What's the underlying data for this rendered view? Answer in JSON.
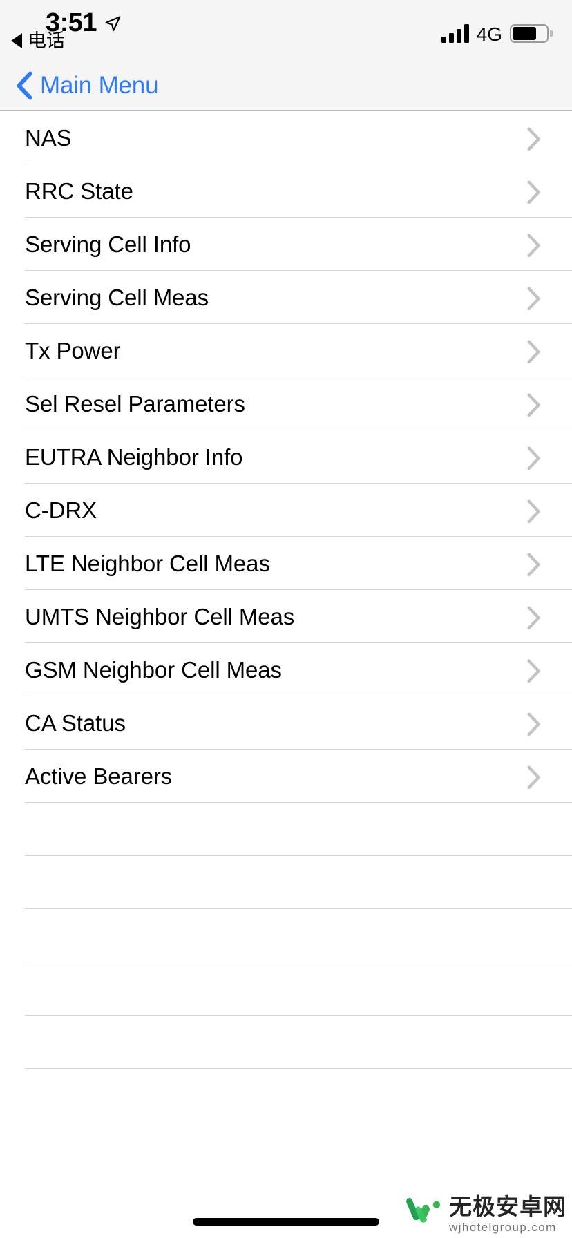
{
  "status_bar": {
    "time": "3:51",
    "location_icon": "location-arrow-icon",
    "return_indicator": {
      "icon": "back-triangle-icon",
      "label": "电话"
    },
    "signal_icon": "cellular-signal-bars-icon",
    "signal_bars": 4,
    "network_type": "4G",
    "battery_icon": "battery-icon"
  },
  "nav_bar": {
    "back_icon": "chevron-left-icon",
    "back_label": "Main Menu"
  },
  "list": {
    "disclosure_icon": "chevron-right-icon",
    "items": [
      {
        "label": "NAS"
      },
      {
        "label": "RRC State"
      },
      {
        "label": "Serving Cell Info"
      },
      {
        "label": "Serving Cell Meas"
      },
      {
        "label": "Tx Power"
      },
      {
        "label": "Sel Resel Parameters"
      },
      {
        "label": "EUTRA Neighbor Info"
      },
      {
        "label": "C-DRX"
      },
      {
        "label": "LTE Neighbor Cell Meas"
      },
      {
        "label": "UMTS Neighbor Cell Meas"
      },
      {
        "label": "GSM Neighbor Cell Meas"
      },
      {
        "label": "CA Status"
      },
      {
        "label": "Active Bearers"
      }
    ],
    "empty_row_count": 5
  },
  "watermark": {
    "logo_icon": "w-logo-icon",
    "title": "无极安卓网",
    "url": "wjhotelgroup.com"
  },
  "home_indicator": "home-indicator",
  "colors": {
    "accent_blue": "#2f7bf6",
    "bar_background": "#f5f5f6",
    "separator": "#d6d6d8",
    "chevron_gray": "#c4c4c6",
    "watermark_green": "#1faa54"
  }
}
